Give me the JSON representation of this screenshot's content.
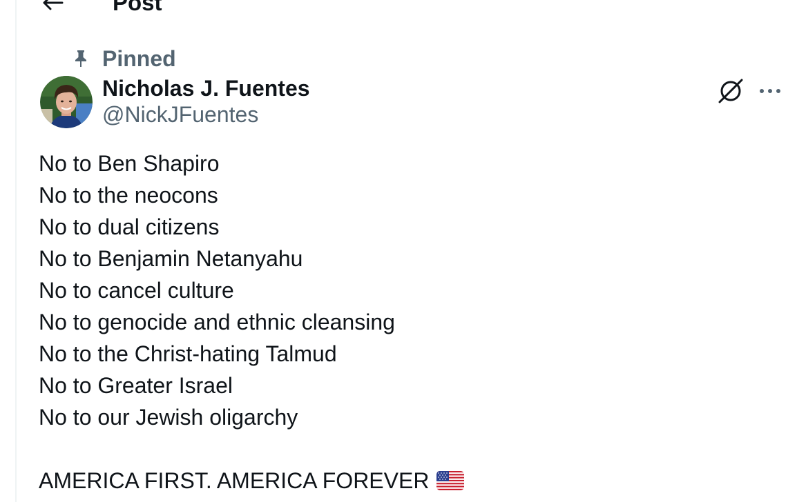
{
  "header": {
    "title": "Post",
    "back_icon": "arrow-left-icon"
  },
  "pinned": {
    "label": "Pinned",
    "icon": "pin-icon"
  },
  "author": {
    "name": "Nicholas J. Fuentes",
    "handle": "@NickJFuentes"
  },
  "actions": {
    "grok_icon": "grok-icon",
    "more_icon": "more-horizontal-icon"
  },
  "post": {
    "lines": [
      "No to Ben Shapiro",
      "No to the neocons",
      "No to dual citizens",
      "No to Benjamin Netanyahu",
      "No to cancel culture",
      "No to genocide and ethnic cleansing",
      "No to the Christ-hating Talmud",
      "No to Greater Israel",
      "No to our Jewish oligarchy"
    ],
    "closing": "AMERICA FIRST. AMERICA FOREVER",
    "closing_emoji": "us-flag-icon"
  },
  "colors": {
    "text_primary": "#0f1419",
    "text_secondary": "#536471",
    "background": "#ffffff"
  }
}
